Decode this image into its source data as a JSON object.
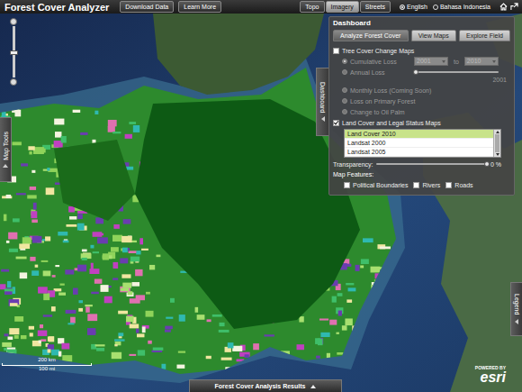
{
  "app": {
    "title": "Forest Cover Analyzer"
  },
  "header_buttons": [
    "Download Data",
    "Learn More"
  ],
  "basemap_tabs": [
    {
      "label": "Topo",
      "selected": false
    },
    {
      "label": "Imagery",
      "selected": true
    },
    {
      "label": "Streets",
      "selected": false
    }
  ],
  "languages": [
    {
      "label": "English",
      "selected": true
    },
    {
      "label": "Bahasa Indonesia",
      "selected": false
    }
  ],
  "zoom_slider": {
    "level": 0.5
  },
  "map_tools_tab": {
    "label": "Map Tools"
  },
  "dashboard_tab": {
    "label": "Dashboard"
  },
  "legend_tab": {
    "label": "Legend"
  },
  "results_tab": {
    "label": "Forest Cover Analysis Results"
  },
  "scale_bar": {
    "top": "200 km",
    "bottom": "100 mi"
  },
  "attribution": {
    "prefix": "POWERED BY",
    "brand": "esri"
  },
  "dashboard": {
    "title": "Dashboard",
    "tabs": [
      {
        "label": "Analyze Forest Cover",
        "selected": true
      },
      {
        "label": "View Maps",
        "selected": false
      },
      {
        "label": "Explore Field",
        "selected": false
      }
    ],
    "tree_cover": {
      "label": "Tree Cover Change Maps",
      "checked": false,
      "options": [
        {
          "kind": "range",
          "label": "Cumulative Loss",
          "selected": true,
          "disabled": true,
          "from": "2001",
          "separator": "to",
          "to": "2010"
        },
        {
          "kind": "slider",
          "label": "Annual Loss",
          "selected": false,
          "disabled": true,
          "level": 0,
          "reading": "2001"
        },
        {
          "kind": "plain",
          "label": "Monthly Loss (Coming Soon)",
          "selected": false,
          "disabled": true
        },
        {
          "kind": "plain",
          "label": "Loss on Primary Forest",
          "selected": false,
          "disabled": true
        },
        {
          "kind": "plain",
          "label": "Change to Oil Palm",
          "selected": false,
          "disabled": true
        }
      ]
    },
    "land_cover": {
      "label": "Land Cover and Legal Status Maps",
      "checked": true,
      "layers": [
        {
          "label": "Land Cover 2010",
          "selected": true
        },
        {
          "label": "Landsat 2000",
          "selected": false
        },
        {
          "label": "Landsat 2005",
          "selected": false
        }
      ],
      "transparency": {
        "label": "Transparency:",
        "level": 1,
        "reading": "0 %"
      }
    },
    "map_features": {
      "label": "Map Features:",
      "items": [
        {
          "label": "Political Boundaries",
          "checked": false
        },
        {
          "label": "Rivers",
          "checked": false
        },
        {
          "label": "Roads",
          "checked": false
        }
      ]
    }
  }
}
